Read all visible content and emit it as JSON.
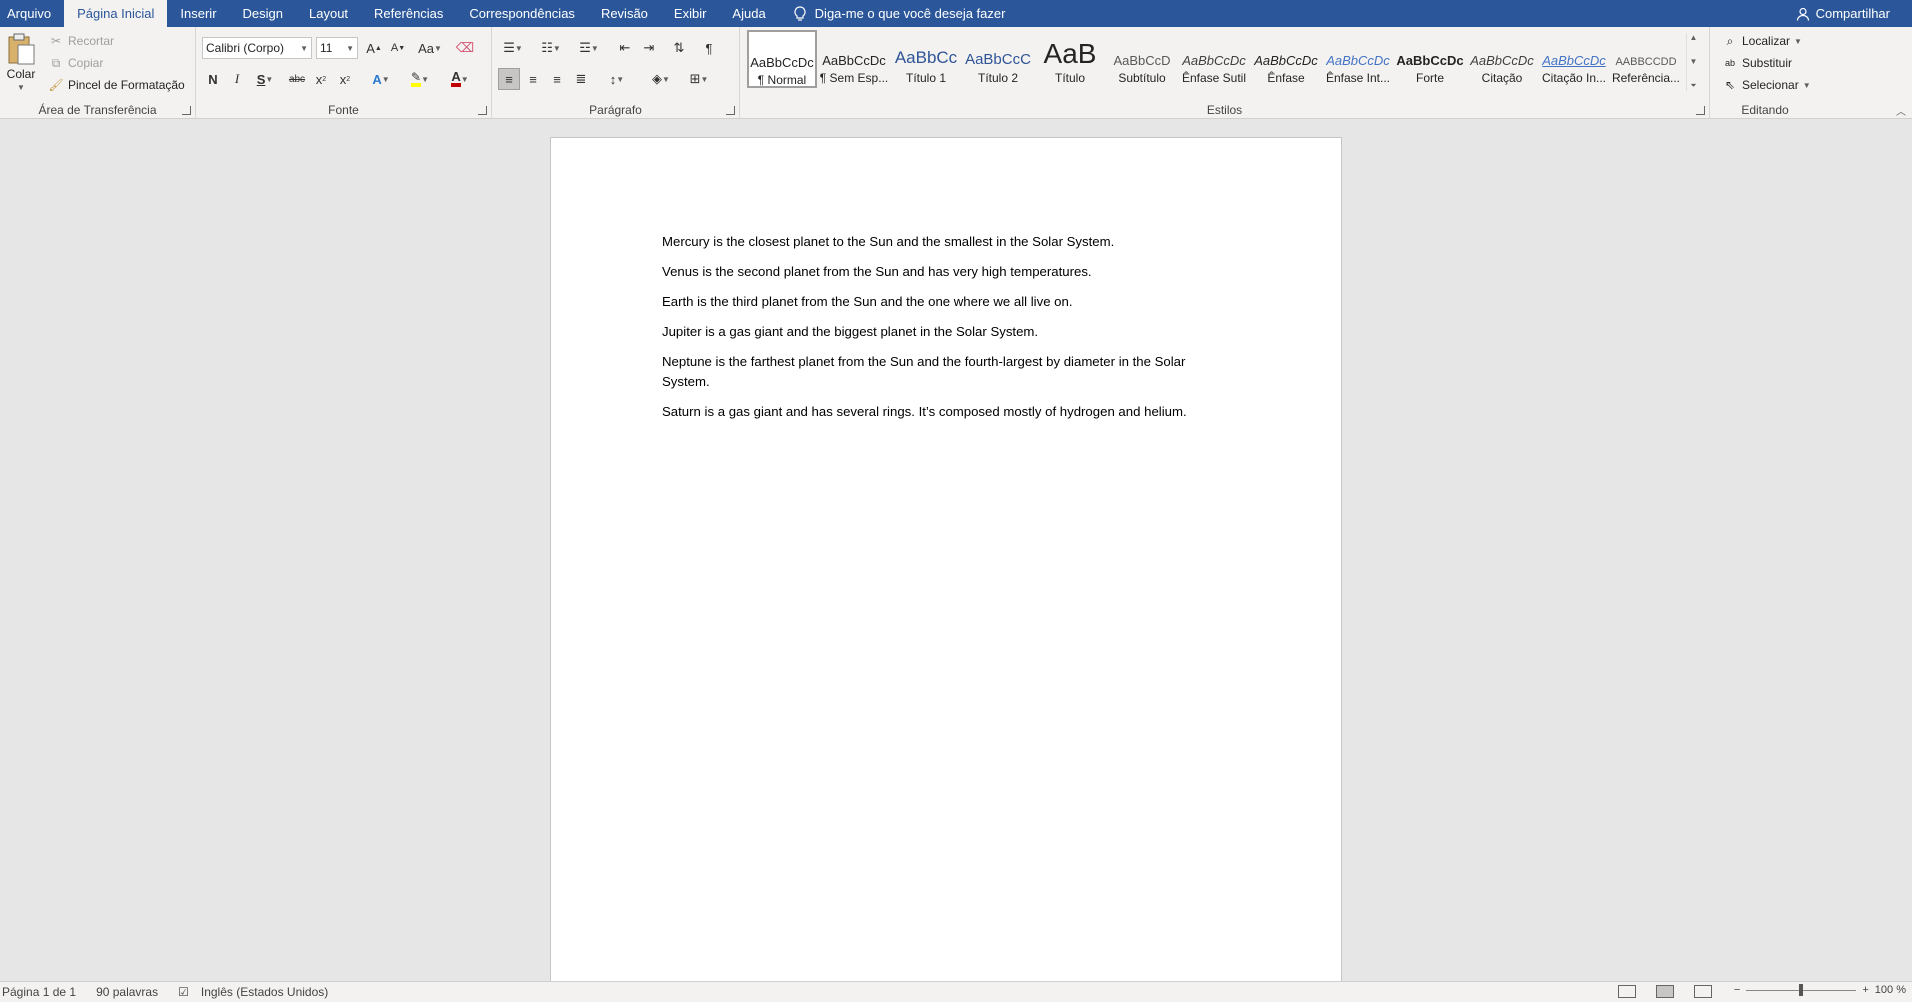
{
  "tabs": [
    "Arquivo",
    "Página Inicial",
    "Inserir",
    "Design",
    "Layout",
    "Referências",
    "Correspondências",
    "Revisão",
    "Exibir",
    "Ajuda"
  ],
  "tell_me": "Diga-me o que você deseja fazer",
  "share": "Compartilhar",
  "clipboard": {
    "paste": "Colar",
    "cut": "Recortar",
    "copy": "Copiar",
    "format_painter": "Pincel de Formatação",
    "label": "Área de Transferência"
  },
  "font": {
    "name": "Calibri (Corpo)",
    "size": "11",
    "grow": "A",
    "shrink": "A",
    "case": "Aa",
    "bold": "N",
    "italic": "I",
    "underline": "S",
    "strike": "abc",
    "sub": "x",
    "sup": "x",
    "label": "Fonte",
    "highlight_color": "#ffff00",
    "font_color": "#c00000"
  },
  "paragraph": {
    "label": "Parágrafo"
  },
  "styles": {
    "label": "Estilos",
    "items": [
      {
        "preview": "AaBbCcDc",
        "name": "¶ Normal"
      },
      {
        "preview": "AaBbCcDc",
        "name": "¶ Sem Esp..."
      },
      {
        "preview": "AaBbCc",
        "name": "Título 1"
      },
      {
        "preview": "AaBbCcC",
        "name": "Título 2"
      },
      {
        "preview": "AaB",
        "name": "Título"
      },
      {
        "preview": "AaBbCcD",
        "name": "Subtítulo"
      },
      {
        "preview": "AaBbCcDc",
        "name": "Ênfase Sutil"
      },
      {
        "preview": "AaBbCcDc",
        "name": "Ênfase"
      },
      {
        "preview": "AaBbCcDc",
        "name": "Ênfase Int..."
      },
      {
        "preview": "AaBbCcDc",
        "name": "Forte"
      },
      {
        "preview": "AaBbCcDc",
        "name": "Citação"
      },
      {
        "preview": "AaBbCcDc",
        "name": "Citação In..."
      },
      {
        "preview": "AABBCCDD",
        "name": "Referência..."
      }
    ]
  },
  "editing": {
    "find": "Localizar",
    "replace": "Substituir",
    "select": "Selecionar",
    "label": "Editando"
  },
  "document": {
    "paragraphs": [
      "Mercury is the closest planet to the Sun and the smallest in the Solar System.",
      "Venus is the second planet from the Sun and has very high temperatures.",
      "Earth is the third planet from the Sun and the one where we all live on.",
      "Jupiter is a gas giant and the biggest planet in the Solar System.",
      "Neptune is the farthest planet from the Sun and the fourth-largest by diameter in the Solar System.",
      "Saturn is a gas giant and has several rings. It’s composed mostly of hydrogen and helium."
    ]
  },
  "status": {
    "page": "Página 1 de 1",
    "words": "90 palavras",
    "language": "Inglês (Estados Unidos)",
    "zoom": "100 %"
  },
  "colors": {
    "brand": "#2b579a"
  }
}
